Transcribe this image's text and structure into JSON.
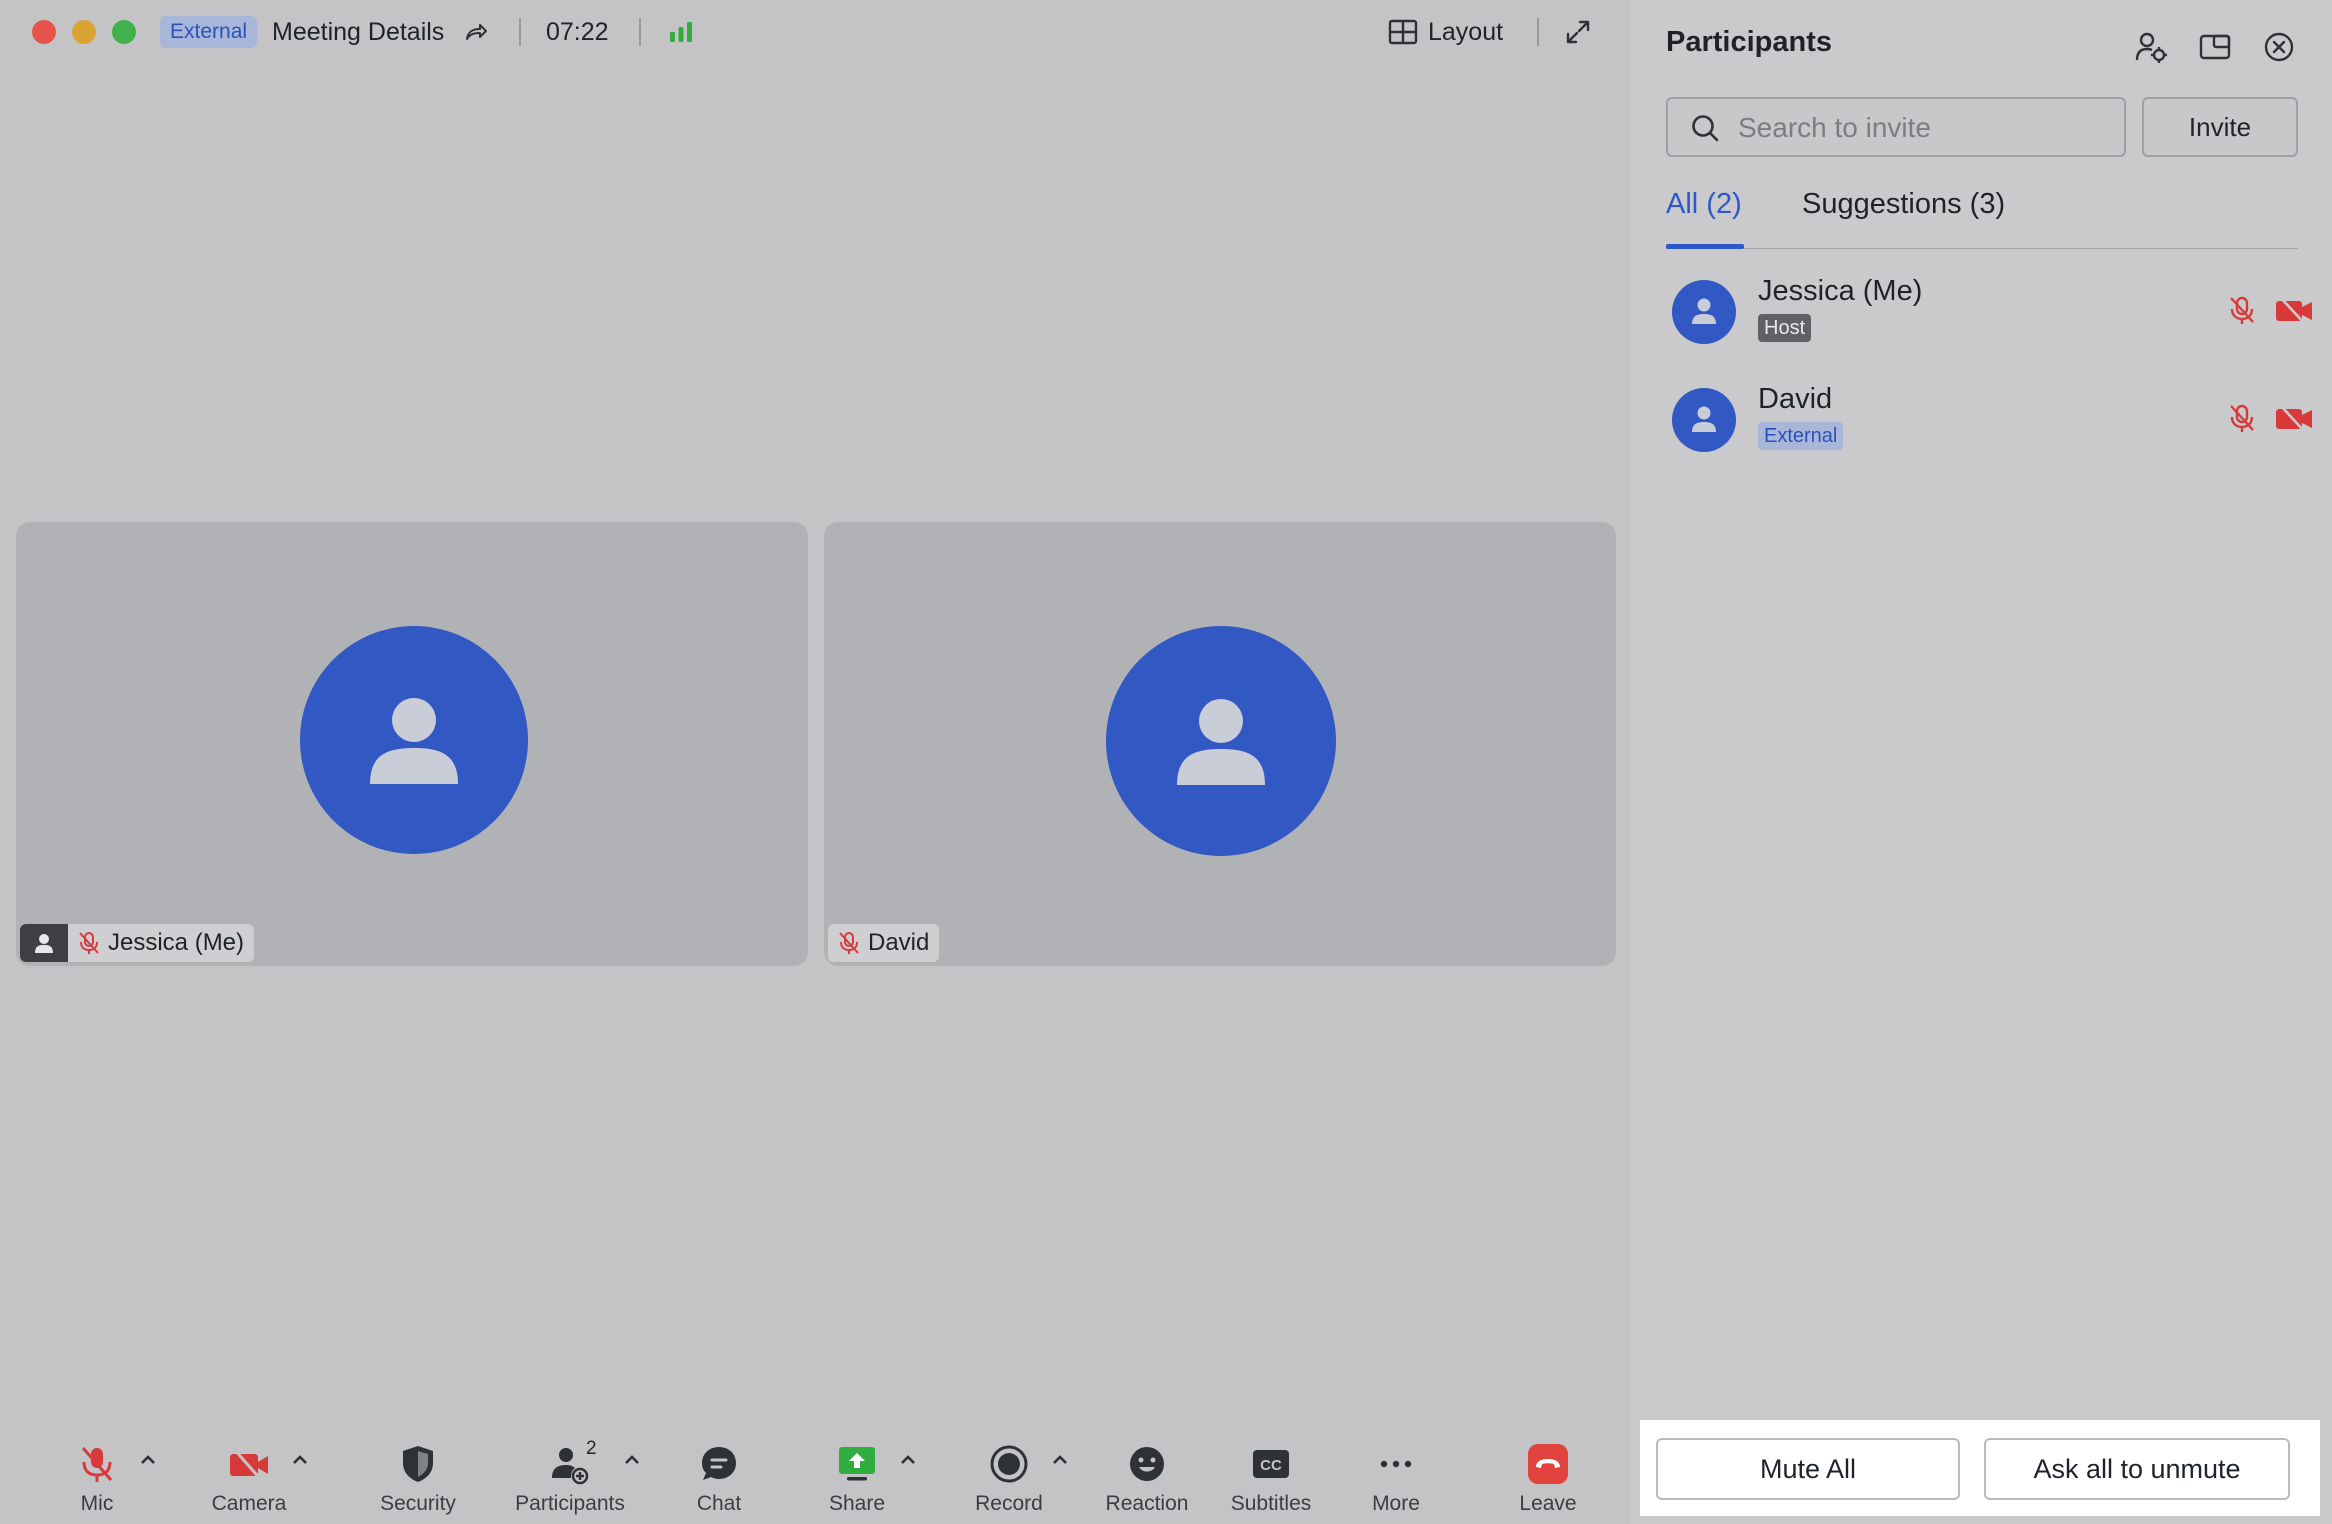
{
  "titlebar": {
    "external_badge": "External",
    "meeting_title": "Meeting Details",
    "timer": "07:22",
    "layout_label": "Layout"
  },
  "tiles": [
    {
      "name": "Jessica (Me)"
    },
    {
      "name": "David"
    }
  ],
  "toolbar": {
    "mic": "Mic",
    "camera": "Camera",
    "security": "Security",
    "participants": "Participants",
    "participants_count": "2",
    "chat": "Chat",
    "share": "Share",
    "record": "Record",
    "reaction": "Reaction",
    "subtitles": "Subtitles",
    "more": "More",
    "leave": "Leave"
  },
  "panel": {
    "title": "Participants",
    "search_placeholder": "Search to invite",
    "invite": "Invite",
    "tabs": [
      {
        "label": "All (2)",
        "active": true
      },
      {
        "label": "Suggestions (3)",
        "active": false
      }
    ],
    "participants": [
      {
        "name": "Jessica (Me)",
        "tag": "Host"
      },
      {
        "name": "David",
        "tag": "External"
      }
    ],
    "mute_all": "Mute All",
    "ask_unmute": "Ask all to unmute"
  },
  "colors": {
    "accent": "#2c58c9",
    "avatar": "#3258c4",
    "muted_red": "#d83a3a",
    "share_green": "#2fae3e",
    "leave_red": "#e3433f"
  },
  "icons": [
    "share-link-icon",
    "signal-icon",
    "layout-icon",
    "expand-icon",
    "user-icon",
    "mic-off-icon",
    "camera-off-icon",
    "shield-icon",
    "participants-icon",
    "chat-icon",
    "share-screen-icon",
    "record-icon",
    "reaction-icon",
    "subtitles-icon",
    "more-icon",
    "leave-icon",
    "participant-settings-icon",
    "pop-out-icon",
    "close-icon",
    "search-icon"
  ]
}
